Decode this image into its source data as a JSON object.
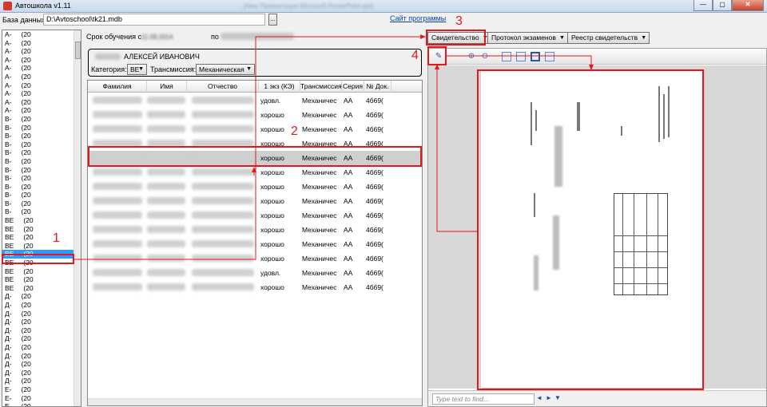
{
  "window": {
    "title": "Автошкола v1.11",
    "blurred_title": "- [New Презентация Microsoft PowerPoint.ppt]",
    "min": "—",
    "max": "▢",
    "close": "✕"
  },
  "db": {
    "label": "База данных:",
    "path": "D:\\Avtoschool\\tk21.mdb",
    "browse": "...",
    "site_link": "Сайт программы"
  },
  "groups": [
    {
      "code": "A-",
      "year": "(20"
    },
    {
      "code": "A-",
      "year": "(20"
    },
    {
      "code": "A-",
      "year": "(20"
    },
    {
      "code": "A-",
      "year": "(20"
    },
    {
      "code": "A-",
      "year": "(20"
    },
    {
      "code": "A-",
      "year": "(20"
    },
    {
      "code": "A-",
      "year": "(20"
    },
    {
      "code": "A-",
      "year": "(20"
    },
    {
      "code": "A-",
      "year": "(20"
    },
    {
      "code": "A-",
      "year": "(20"
    },
    {
      "code": "B-",
      "year": "(20"
    },
    {
      "code": "B-",
      "year": "(20"
    },
    {
      "code": "B-",
      "year": "(20"
    },
    {
      "code": "B-",
      "year": "(20"
    },
    {
      "code": "B-",
      "year": "(20"
    },
    {
      "code": "B-",
      "year": "(20"
    },
    {
      "code": "B-",
      "year": "(20"
    },
    {
      "code": "B-",
      "year": "(20"
    },
    {
      "code": "B-",
      "year": "(20"
    },
    {
      "code": "B-",
      "year": "(20"
    },
    {
      "code": "B-",
      "year": "(20"
    },
    {
      "code": "B-",
      "year": "(20"
    },
    {
      "code": "BE",
      "year": "(20"
    },
    {
      "code": "BE",
      "year": "(20"
    },
    {
      "code": "BE",
      "year": "(20"
    },
    {
      "code": "BE",
      "year": "(20"
    },
    {
      "code": "BE",
      "year": "(20"
    },
    {
      "code": "BE",
      "year": "(20"
    },
    {
      "code": "BE",
      "year": "(20"
    },
    {
      "code": "BE",
      "year": "(20"
    },
    {
      "code": "BE",
      "year": "(20"
    },
    {
      "code": "Д-",
      "year": "(20"
    },
    {
      "code": "Д-",
      "year": "(20"
    },
    {
      "code": "Д-",
      "year": "(20"
    },
    {
      "code": "Д-",
      "year": "(20"
    },
    {
      "code": "Д-",
      "year": "(20"
    },
    {
      "code": "Д-",
      "year": "(20"
    },
    {
      "code": "Д-",
      "year": "(20"
    },
    {
      "code": "Д-",
      "year": "(20"
    },
    {
      "code": "Д-",
      "year": "(20"
    },
    {
      "code": "Д-",
      "year": "(20"
    },
    {
      "code": "Д-",
      "year": "(20"
    },
    {
      "code": "E-",
      "year": "(20"
    },
    {
      "code": "E-",
      "year": "(20"
    },
    {
      "code": "E-",
      "year": "(20"
    }
  ],
  "selected_group_index": 26,
  "period": {
    "label": "Срок обучения с",
    "from_blurred": "11.09.2014",
    "to_label": "по",
    "to_blurred": ""
  },
  "student": {
    "name": "АЛЕКСЕЙ  ИВАНОВИЧ",
    "category_label": "Категория:",
    "category_value": "BE",
    "transmission_label": "Трансмиссия:",
    "transmission_value": "Механическая"
  },
  "grid": {
    "columns": [
      "Фамилия",
      "Имя",
      "Отчество",
      "1 экз (КЭ)",
      "Трансмиссия",
      "Серия",
      "№ Док."
    ],
    "rows": [
      {
        "exam": "удовл.",
        "trans": "Механичес",
        "series": "AA",
        "doc": "4б69("
      },
      {
        "exam": "хорошо",
        "trans": "Механичес",
        "series": "AA",
        "doc": "4б69("
      },
      {
        "exam": "хорошо",
        "trans": "Механичес",
        "series": "AA",
        "doc": "4б69("
      },
      {
        "exam": "хорошо",
        "trans": "Механичес",
        "series": "AA",
        "doc": "4б69("
      },
      {
        "exam": "хорошо",
        "trans": "Механичес",
        "series": "AA",
        "doc": "4б69("
      },
      {
        "exam": "хорошо",
        "trans": "Механичес",
        "series": "AA",
        "doc": "4б69("
      },
      {
        "exam": "хорошо",
        "trans": "Механичес",
        "series": "AA",
        "doc": "4б69("
      },
      {
        "exam": "хорошо",
        "trans": "Механичес",
        "series": "AA",
        "doc": "4б69("
      },
      {
        "exam": "хорошо",
        "trans": "Механичес",
        "series": "AA",
        "doc": "4б69("
      },
      {
        "exam": "хорошо",
        "trans": "Механичес",
        "series": "AA",
        "doc": "4б69("
      },
      {
        "exam": "хорошо",
        "trans": "Механичес",
        "series": "AA",
        "doc": "4б69("
      },
      {
        "exam": "хорошо",
        "trans": "Механичес",
        "series": "AA",
        "doc": "4б69("
      },
      {
        "exam": "удовл.",
        "trans": "Механичес",
        "series": "AA",
        "doc": "4б69("
      },
      {
        "exam": "хорошо",
        "trans": "Механичес",
        "series": "AA",
        "doc": "4б69("
      }
    ],
    "selected_row_index": 4
  },
  "toolbar": {
    "certificate": "Свидетельство",
    "protocol": "Протокол экзаменов",
    "registry": "Реестр свидетельств"
  },
  "preview": {
    "find_placeholder": "Type text to find...",
    "find_prev": "◄",
    "find_next": "►",
    "find_opts": "▼"
  },
  "annotations": {
    "n1": "1",
    "n2": "2",
    "n3": "3",
    "n4": "4"
  },
  "colors": {
    "highlight": "#e0191e",
    "selection": "#3399ff"
  }
}
